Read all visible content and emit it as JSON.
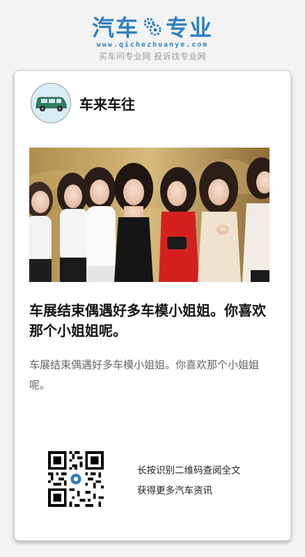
{
  "brand": {
    "word_left": "汽车",
    "word_right": "专业",
    "url": "www.qichezhuanye.com",
    "tagline": "买车问专业网 投诉找专业网",
    "color": "#2f7fc1"
  },
  "author": {
    "name": "车来车往",
    "avatar_icon": "car-icon"
  },
  "article": {
    "photo_icon": "group-photo",
    "title": "车展结束偶遇好多车模小姐姐。你喜欢那个小姐姐呢。",
    "summary": "车展结束偶遇好多车模小姐姐。你喜欢那个小姐姐呢。"
  },
  "footer": {
    "qr_icon": "qr-code-icon",
    "line1": "长按识别二维码查阅全文",
    "line2": "获得更多汽车资讯"
  }
}
